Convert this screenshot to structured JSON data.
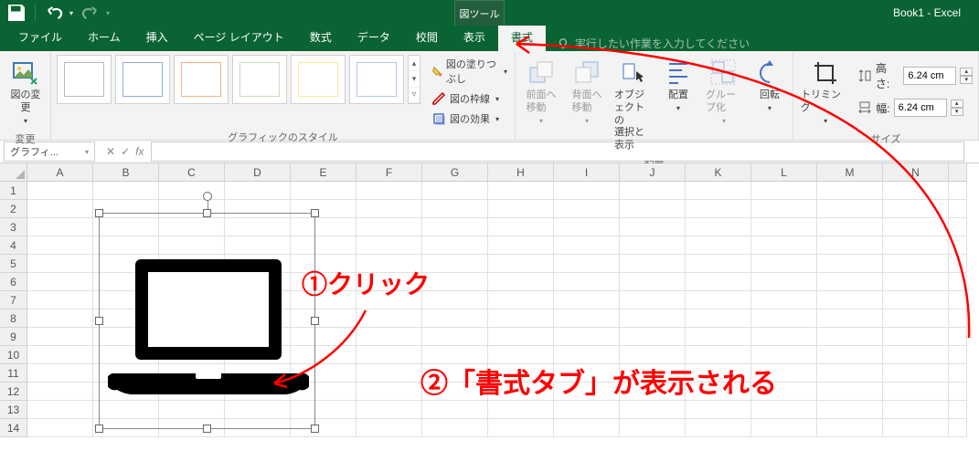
{
  "app": {
    "doc_title": "Book1 - Excel",
    "tool_tab": "図ツール"
  },
  "qat": {
    "save": "保存",
    "undo": "元に戻す",
    "redo": "やり直し"
  },
  "tabs": {
    "file": "ファイル",
    "home": "ホーム",
    "insert": "挿入",
    "page_layout": "ページ レイアウト",
    "formulas": "数式",
    "data": "データ",
    "review": "校閲",
    "view": "表示",
    "format": "書式",
    "tellme_placeholder": "実行したい作業を入力してください"
  },
  "ribbon": {
    "change": {
      "change_picture": "図の変\n更",
      "group_label": "変更"
    },
    "styles": {
      "group_label": "グラフィックのスタイル",
      "fill": "図の塗りつぶし",
      "outline": "図の枠線",
      "effects": "図の効果"
    },
    "arrange": {
      "group_label": "配置",
      "bring_forward": "前面へ\n移動",
      "send_backward": "背面へ\n移動",
      "selection_pane": "オブジェクトの\n選択と表示",
      "align": "配置",
      "group": "グループ化",
      "rotate": "回転"
    },
    "size": {
      "group_label": "サイズ",
      "crop": "トリミング",
      "height_label": "高さ:",
      "height_value": "6.24 cm",
      "width_label": "幅:",
      "width_value": "6.24 cm"
    }
  },
  "formula_bar": {
    "name_box": "グラフィ...",
    "fx": "fx"
  },
  "columns": [
    "A",
    "B",
    "C",
    "D",
    "E",
    "F",
    "G",
    "H",
    "I",
    "J",
    "K",
    "L",
    "M",
    "N"
  ],
  "rows": [
    "1",
    "2",
    "3",
    "4",
    "5",
    "6",
    "7",
    "8",
    "9",
    "10",
    "11",
    "12",
    "13",
    "14"
  ],
  "annotations": {
    "a1": "①クリック",
    "a2": "②「書式タブ」が表示される"
  }
}
